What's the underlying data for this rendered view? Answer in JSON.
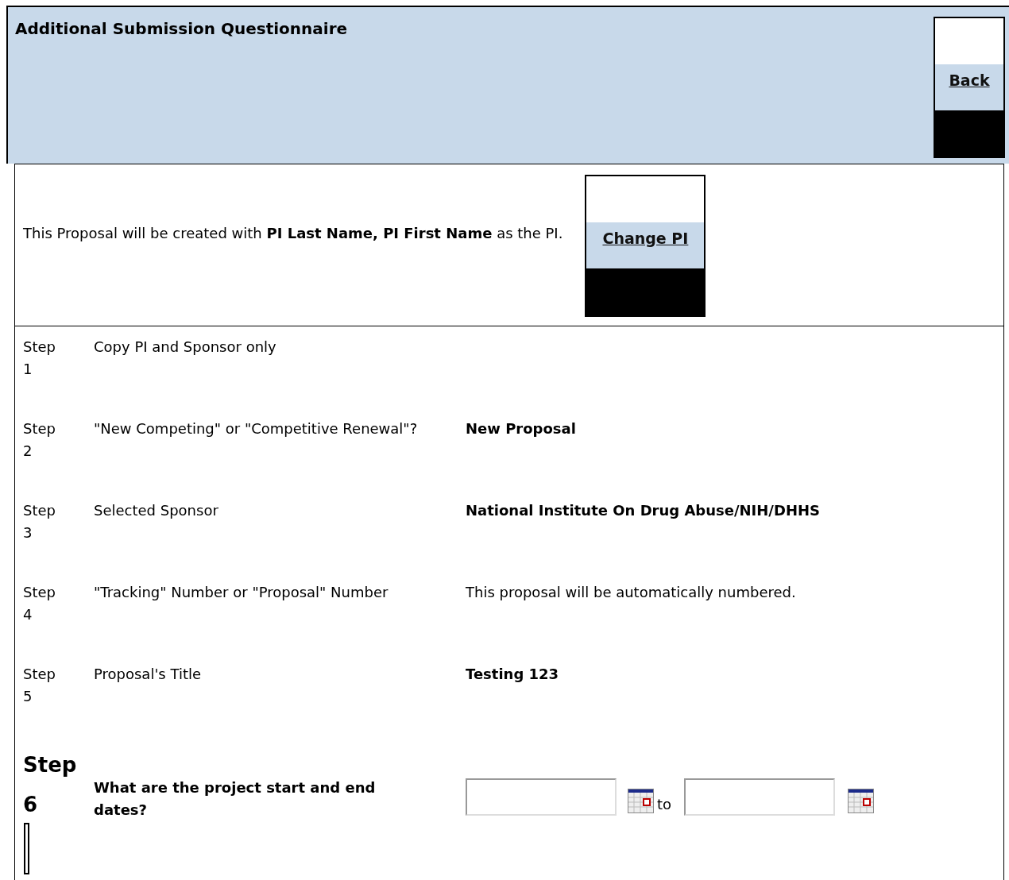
{
  "header": {
    "title": "Additional Submission Questionnaire",
    "back_button": "Back"
  },
  "pi": {
    "sentence": "This Proposal will be created with **PI Last Name, PI First Name** as the PI.",
    "button": "Change PI"
  },
  "steps": [
    {
      "kind": "info",
      "step": "Step 1",
      "label": "Copy PI and Sponsor only"
    },
    {
      "kind": "answer",
      "step": "Step 2",
      "label": "\"New Competing\" or \"Competitive Renewal\"?",
      "value": "New Proposal"
    },
    {
      "kind": "answer",
      "step": "Step 3",
      "label": "Selected Sponsor",
      "value": "National Institute On Drug Abuse/NIH/DHHS"
    },
    {
      "kind": "note",
      "step": "Step 4",
      "label": "\"Tracking\" Number or \"Proposal\" Number",
      "value": "This proposal will be automatically numbered."
    },
    {
      "kind": "answer",
      "step": "Step 5",
      "label": "Proposal's Title",
      "value": "Testing 123"
    },
    {
      "kind": "date-range",
      "step": "Step 6",
      "label": "What are the project start and end dates?",
      "separator": "to"
    }
  ]
}
